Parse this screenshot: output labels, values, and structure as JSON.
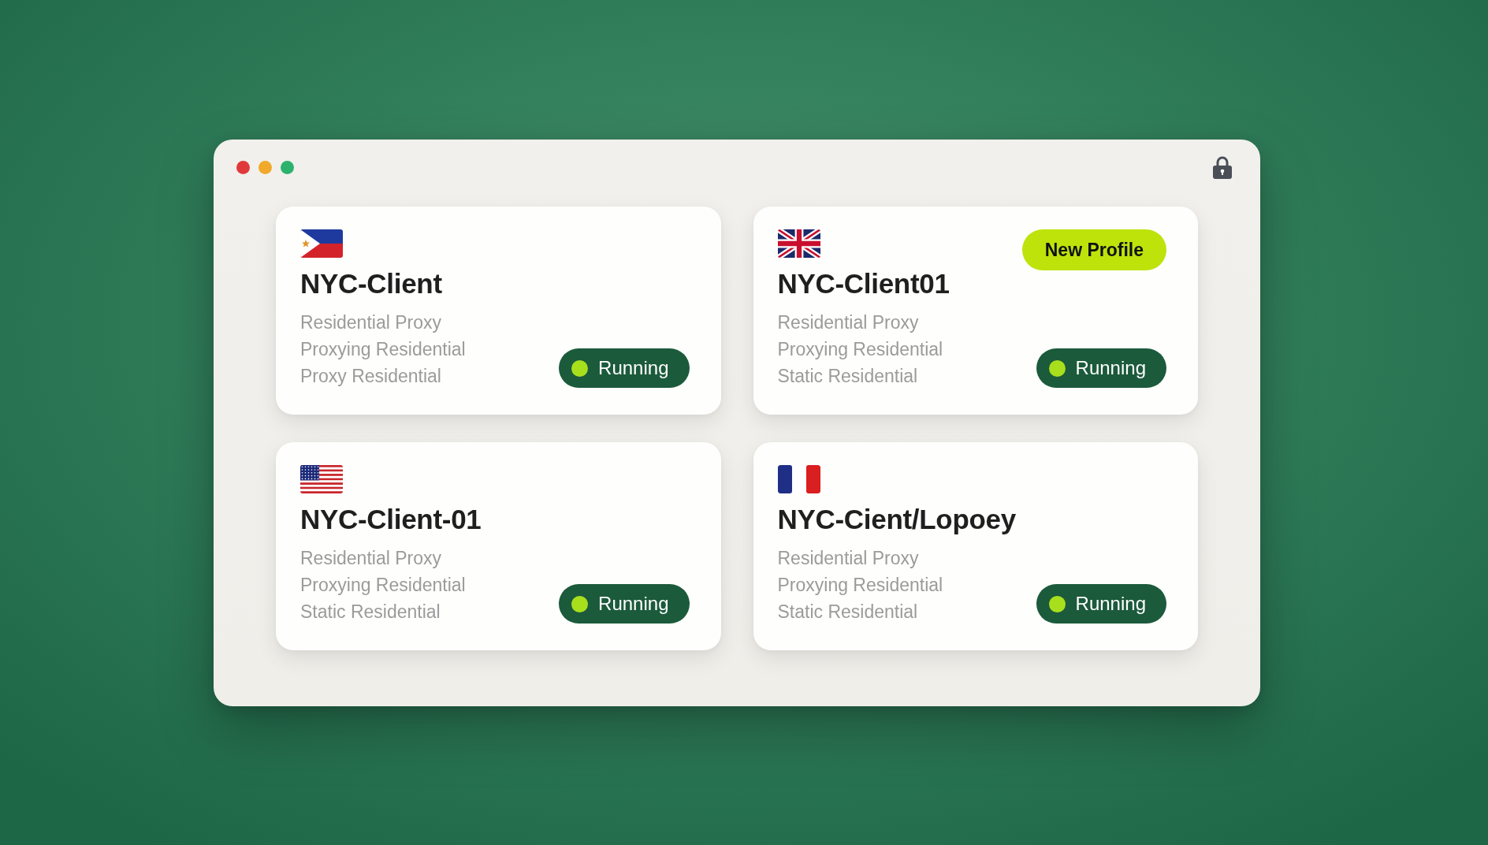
{
  "card_rows": [
    {
      "cards": [
        {
          "kind": "philippines",
          "title": "NYC-Client",
          "lines": [
            "Residential Proxy",
            "Proxying Residential",
            "Proxy Residential"
          ],
          "status": "Running"
        },
        {
          "kind": "uk",
          "title": "NYC-Client01",
          "badge": "New Profile",
          "lines": [
            "Residential Proxy",
            "Proxying Residential",
            "Static Residential"
          ],
          "status": "Running"
        }
      ]
    },
    {
      "cards": [
        {
          "kind": "usa",
          "title": "NYC-Client-01",
          "lines": [
            "Residential Proxy",
            "Proxying Residential",
            "Static Residential"
          ],
          "status": "Running"
        },
        {
          "kind": "france",
          "title": "NYC-Cient/Lopoey",
          "lines": [
            "Residential Proxy",
            "Proxying Residential",
            "Static Residential"
          ],
          "status": "Running"
        }
      ]
    }
  ]
}
